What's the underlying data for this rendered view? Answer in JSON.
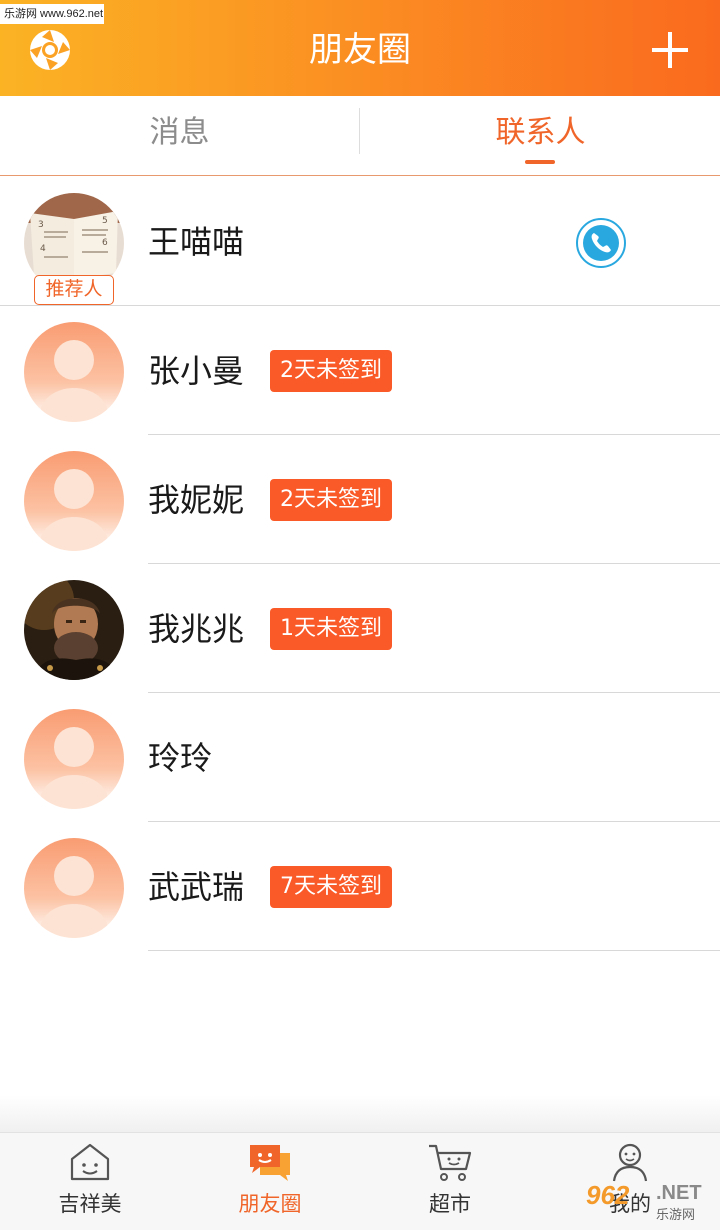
{
  "watermark": {
    "top_text": "乐游网 www.962.net",
    "bottom_num": "962",
    "bottom_net": ".NET",
    "bottom_cn": "乐游网"
  },
  "header": {
    "title": "朋友圈",
    "logo_icon": "shutter-logo-icon",
    "add_icon": "plus-icon"
  },
  "tabs": [
    {
      "label": "消息",
      "active": false
    },
    {
      "label": "联系人",
      "active": true
    }
  ],
  "contacts": [
    {
      "name": "王喵喵",
      "tag": "推荐人",
      "avatar": "book-photo",
      "action_icon": "phone-icon"
    },
    {
      "name": "张小曼",
      "badge": "2天未签到",
      "avatar": "default-avatar-icon"
    },
    {
      "name": "我妮妮",
      "badge": "2天未签到",
      "avatar": "default-avatar-icon"
    },
    {
      "name": "我兆兆",
      "badge": "1天未签到",
      "avatar": "man-portrait-photo"
    },
    {
      "name": "玲玲",
      "avatar": "default-avatar-icon"
    },
    {
      "name": "武武瑞",
      "badge": "7天未签到",
      "avatar": "default-avatar-icon"
    }
  ],
  "bottom_nav": [
    {
      "label": "吉祥美",
      "icon": "home-face-icon",
      "active": false
    },
    {
      "label": "朋友圈",
      "icon": "chat-bubbles-icon",
      "active": true
    },
    {
      "label": "超市",
      "icon": "shopping-cart-icon",
      "active": false
    },
    {
      "label": "我的",
      "icon": "user-icon",
      "active": false
    }
  ],
  "colors": {
    "accent": "#f0662a",
    "badge": "#fa5a28",
    "header_start": "#fbb324",
    "header_end": "#fa6a1e",
    "call": "#29a8e0"
  }
}
